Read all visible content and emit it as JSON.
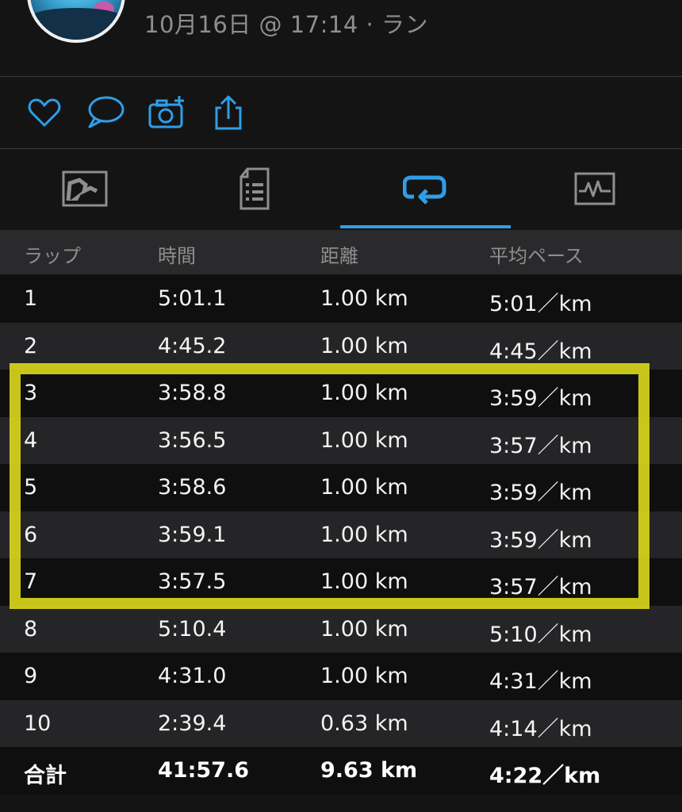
{
  "header": {
    "subtitle": "10月16日 @ 17:14 · ラン"
  },
  "actions": {
    "icons": [
      "heart-icon",
      "comment-icon",
      "add-photo-icon",
      "share-icon"
    ]
  },
  "tabs": {
    "items": [
      "map-tab",
      "summary-tab",
      "laps-tab",
      "charts-tab"
    ],
    "active": "laps-tab"
  },
  "colors": {
    "accent": "#2f9ee8",
    "highlight_box": "#d8d41a"
  },
  "laps_table": {
    "headers": {
      "lap": "ラップ",
      "time": "時間",
      "distance": "距離",
      "avg_pace": "平均ペース"
    },
    "rows": [
      {
        "lap": "1",
        "time": "5:01.1",
        "distance": "1.00 km",
        "pace": "5:01／km"
      },
      {
        "lap": "2",
        "time": "4:45.2",
        "distance": "1.00 km",
        "pace": "4:45／km"
      },
      {
        "lap": "3",
        "time": "3:58.8",
        "distance": "1.00 km",
        "pace": "3:59／km"
      },
      {
        "lap": "4",
        "time": "3:56.5",
        "distance": "1.00 km",
        "pace": "3:57／km"
      },
      {
        "lap": "5",
        "time": "3:58.6",
        "distance": "1.00 km",
        "pace": "3:59／km"
      },
      {
        "lap": "6",
        "time": "3:59.1",
        "distance": "1.00 km",
        "pace": "3:59／km"
      },
      {
        "lap": "7",
        "time": "3:57.5",
        "distance": "1.00 km",
        "pace": "3:57／km"
      },
      {
        "lap": "8",
        "time": "5:10.4",
        "distance": "1.00 km",
        "pace": "5:10／km"
      },
      {
        "lap": "9",
        "time": "4:31.0",
        "distance": "1.00 km",
        "pace": "4:31／km"
      },
      {
        "lap": "10",
        "time": "2:39.4",
        "distance": "0.63 km",
        "pace": "4:14／km"
      }
    ],
    "total": {
      "lap": "合計",
      "time": "41:57.6",
      "distance": "9.63 km",
      "pace": "4:22／km"
    }
  }
}
